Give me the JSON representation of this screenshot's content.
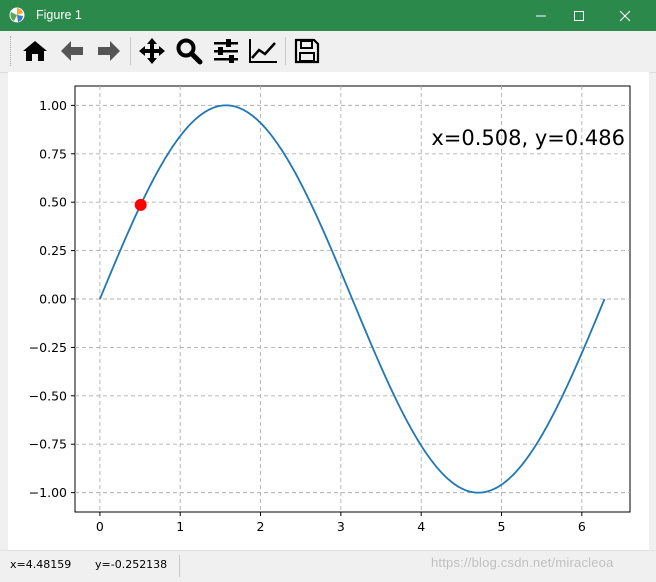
{
  "window": {
    "title": "Figure 1",
    "minimize_glyph": "—",
    "maximize_glyph": "☐",
    "close_glyph": "✕"
  },
  "toolbar": {
    "buttons": [
      {
        "name": "home-button",
        "icon": "home-icon"
      },
      {
        "name": "back-button",
        "icon": "arrow-left-icon"
      },
      {
        "name": "forward-button",
        "icon": "arrow-right-icon"
      },
      {
        "name": "pan-button",
        "icon": "move-icon"
      },
      {
        "name": "zoom-button",
        "icon": "magnifier-icon"
      },
      {
        "name": "subplots-button",
        "icon": "sliders-icon"
      },
      {
        "name": "edit-axis-button",
        "icon": "line-chart-icon"
      },
      {
        "name": "save-button",
        "icon": "floppy-disk-icon"
      }
    ]
  },
  "annotation": {
    "text": "x=0.508, y=0.486"
  },
  "status": {
    "x_readout": "x=4.48159",
    "y_readout": "y=-0.252138"
  },
  "watermark": "https://blog.csdn.net/miracleoa",
  "chart_data": {
    "type": "line",
    "function": "sin(x)",
    "x_range": [
      0,
      6.283
    ],
    "xlim": [
      -0.31,
      6.6
    ],
    "ylim": [
      -1.1,
      1.1
    ],
    "xticks": [
      0,
      1,
      2,
      3,
      4,
      5,
      6
    ],
    "xtick_labels": [
      "0",
      "1",
      "2",
      "3",
      "4",
      "5",
      "6"
    ],
    "yticks": [
      -1.0,
      -0.75,
      -0.5,
      -0.25,
      0.0,
      0.25,
      0.5,
      0.75,
      1.0
    ],
    "ytick_labels": [
      "−1.00",
      "−0.75",
      "−0.50",
      "−0.25",
      "0.00",
      "0.25",
      "0.50",
      "0.75",
      "1.00"
    ],
    "grid": true,
    "grid_style": "dashed",
    "series": [
      {
        "color": "#1f77b4"
      }
    ],
    "marker_point": {
      "x": 0.508,
      "y": 0.486,
      "color": "#ff0000"
    }
  }
}
